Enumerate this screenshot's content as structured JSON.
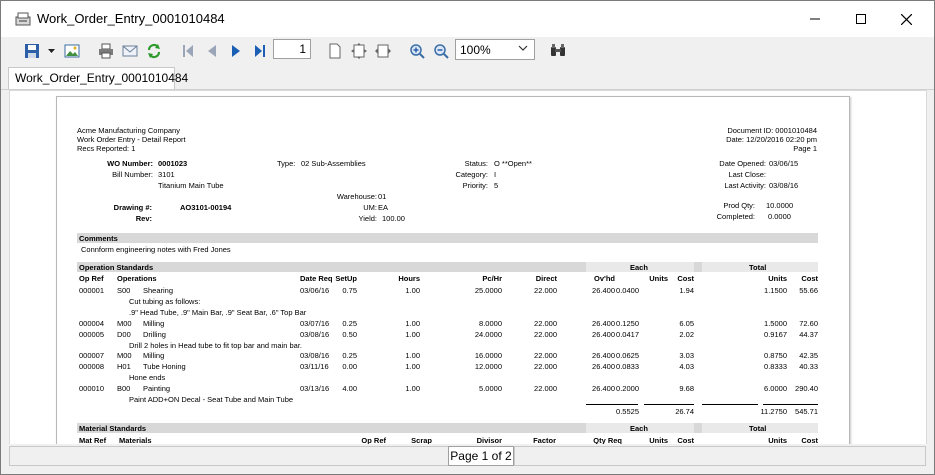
{
  "window": {
    "title": "Work_Order_Entry_0001010484",
    "tab_label": "Work_Order_Entry_0001010484"
  },
  "toolbar": {
    "page_number": "1",
    "zoom": "100%",
    "icons": [
      "save-icon",
      "save-dropdown-icon",
      "export-image-icon",
      "print-icon",
      "email-icon",
      "refresh-icon",
      "first-page-icon",
      "previous-page-icon",
      "next-page-icon",
      "last-page-icon",
      "single-page-icon",
      "fit-page-icon",
      "fit-width-icon",
      "zoom-in-icon",
      "zoom-out-icon",
      "find-icon"
    ]
  },
  "status": {
    "page_indicator": "Page 1 of 2"
  },
  "report": {
    "company": "Acme Manufacturing Company",
    "report_title": "Work Order Entry - Detail Report",
    "recs_reported": "Recs Reported: 1",
    "document_id": "Document ID: 0001010484",
    "date": "Date: 12/20/2016  02:20 pm",
    "page": "Page 1",
    "wo_number_label": "WO Number:",
    "wo_number": "0001023",
    "bill_number_label": "Bill Number:",
    "bill_number": "3101",
    "bill_description": "Titanium Main Tube",
    "type_label": "Type:",
    "type_value": "02 Sub-Assemblies",
    "status_label": "Status:",
    "status_value": "O  **Open**",
    "category_label": "Category:",
    "category_value": "I",
    "priority_label": "Priority:",
    "priority_value": "5",
    "date_opened_label": "Date Opened:",
    "date_opened": "03/06/15",
    "last_close_label": "Last Close:",
    "last_close": "",
    "last_activity_label": "Last Activity:",
    "last_activity": "03/08/16",
    "warehouse_label": "Warehouse:",
    "warehouse": "01",
    "um_label": "UM:",
    "um": "EA",
    "yield_label": "Yield:",
    "yield": "100.00",
    "drawing_label": "Drawing #:",
    "drawing": "AO3101-00194",
    "rev_label": "Rev:",
    "rev": "",
    "prod_qty_label": "Prod Qty:",
    "prod_qty": "10.0000",
    "completed_label": "Completed:",
    "completed": "0.0000",
    "comments_header": "Comments",
    "comment_text": "Connform engineering notes with Fred Jones",
    "op_section": "Operation Standards",
    "each_label": "Each",
    "total_label": "Total",
    "op_headers": {
      "op_ref": "Op Ref",
      "operations": "Operations",
      "date_req": "Date Req",
      "setup": "SetUp",
      "hours": "Hours",
      "pc_hr": "Pc/Hr",
      "direct": "Direct",
      "ovhd": "Ov'hd",
      "units_each": "Units",
      "cost_each": "Cost",
      "units_total": "Units",
      "cost_total": "Cost"
    },
    "op_rows": [
      {
        "ref": "000001",
        "code": "S00",
        "name": "Shearing",
        "date": "03/06/16",
        "setup": "0.75",
        "hours": "1.00",
        "pchr": "25.0000",
        "direct": "22.000",
        "ovhd": "26.400",
        "eu": "0.0400",
        "ec": "1.94",
        "tu": "1.1500",
        "tc": "55.66"
      },
      {
        "note": "Cut tubing as follows:"
      },
      {
        "note": ".9\" Head Tube, .9\" Main Bar, .9\" Seat Bar, .6\" Top Bar"
      },
      {
        "ref": "000004",
        "code": "M00",
        "name": "Milling",
        "date": "03/07/16",
        "setup": "0.25",
        "hours": "1.00",
        "pchr": "8.0000",
        "direct": "22.000",
        "ovhd": "26.400",
        "eu": "0.1250",
        "ec": "6.05",
        "tu": "1.5000",
        "tc": "72.60"
      },
      {
        "ref": "000005",
        "code": "D00",
        "name": "Drilling",
        "date": "03/08/16",
        "setup": "0.50",
        "hours": "1.00",
        "pchr": "24.0000",
        "direct": "22.000",
        "ovhd": "26.400",
        "eu": "0.0417",
        "ec": "2.02",
        "tu": "0.9167",
        "tc": "44.37"
      },
      {
        "note": "Drill 2 holes in Head tube to fit top bar and main bar."
      },
      {
        "ref": "000007",
        "code": "M00",
        "name": "Milling",
        "date": "03/08/16",
        "setup": "0.25",
        "hours": "1.00",
        "pchr": "16.0000",
        "direct": "22.000",
        "ovhd": "26.400",
        "eu": "0.0625",
        "ec": "3.03",
        "tu": "0.8750",
        "tc": "42.35"
      },
      {
        "ref": "000008",
        "code": "H01",
        "name": "Tube Honing",
        "date": "03/11/16",
        "setup": "0.00",
        "hours": "1.00",
        "pchr": "12.0000",
        "direct": "22.000",
        "ovhd": "26.400",
        "eu": "0.0833",
        "ec": "4.03",
        "tu": "0.8333",
        "tc": "40.33"
      },
      {
        "note": "Hone ends"
      },
      {
        "ref": "000010",
        "code": "B00",
        "name": "Painting",
        "date": "03/13/16",
        "setup": "4.00",
        "hours": "1.00",
        "pchr": "5.0000",
        "direct": "22.000",
        "ovhd": "26.400",
        "eu": "0.2000",
        "ec": "9.68",
        "tu": "6.0000",
        "tc": "290.40"
      },
      {
        "note": "Paint ADD+ON Decal - Seat Tube and Main Tube"
      }
    ],
    "op_totals": {
      "eu": "0.5525",
      "ec": "26.74",
      "tu": "11.2750",
      "tc": "545.71"
    },
    "mat_section": "Material Standards",
    "mat_headers": {
      "mat_ref": "Mat Ref",
      "materials": "Materials",
      "op_ref": "Op Ref",
      "scrap": "Scrap",
      "divisor": "Divisor",
      "factor": "Factor",
      "qty_req": "Qty Req",
      "units_each": "Units",
      "cost_each": "Cost",
      "units_total": "Units",
      "cost_total": "Cost"
    }
  }
}
